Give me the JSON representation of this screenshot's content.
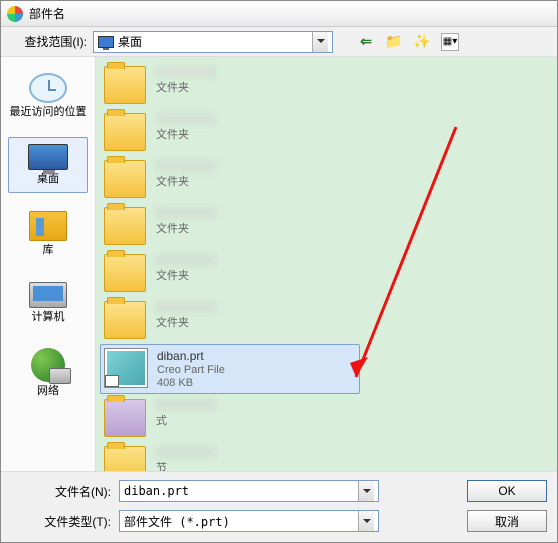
{
  "title": "部件名",
  "look_in": {
    "label": "查找范围(I):",
    "value": "桌面"
  },
  "toolbar_icons": [
    "back-icon",
    "up-icon",
    "new-folder-icon",
    "views-icon"
  ],
  "places": [
    {
      "key": "recent",
      "label": "最近访问的位置"
    },
    {
      "key": "desktop",
      "label": "桌面"
    },
    {
      "key": "libraries",
      "label": "库"
    },
    {
      "key": "computer",
      "label": "计算机"
    },
    {
      "key": "network",
      "label": "网络"
    }
  ],
  "folder_sub": "文件夹",
  "selected_file": {
    "name": "diban.prt",
    "type": "Creo Part File",
    "size": "408 KB"
  },
  "filename": {
    "label": "文件名(N):",
    "value": "diban.prt"
  },
  "filetype": {
    "label": "文件类型(T):",
    "value": "部件文件 (*.prt)"
  },
  "buttons": {
    "ok": "OK",
    "cancel": "取消"
  }
}
